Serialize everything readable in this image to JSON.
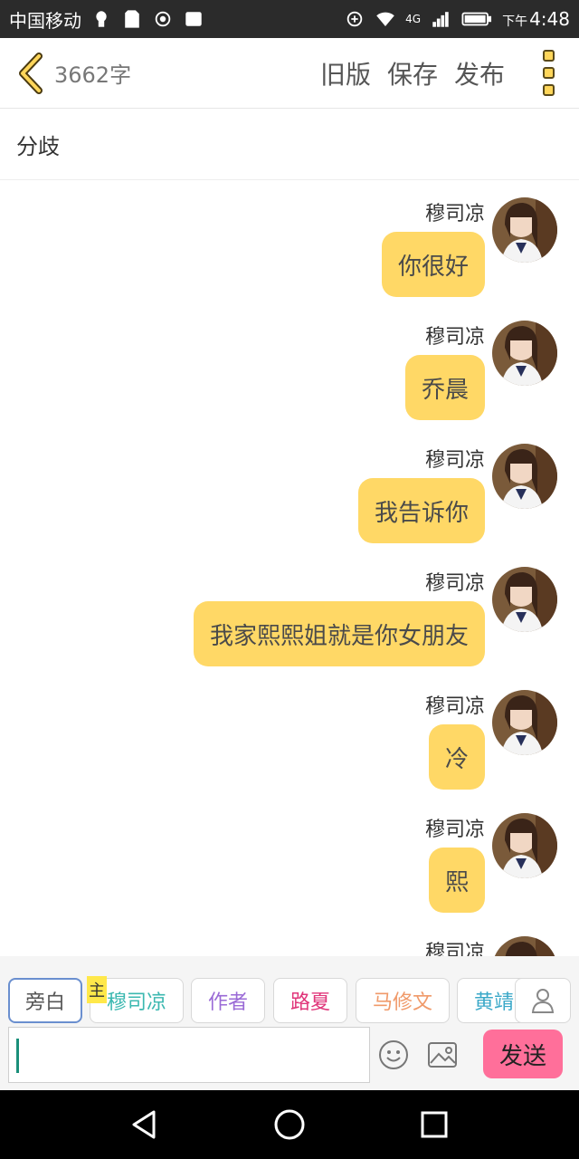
{
  "status_bar": {
    "carrier": "中国移动",
    "time_prefix": "下午",
    "time": "4:48",
    "network": "4G"
  },
  "header": {
    "word_count": "3662字",
    "actions": [
      "旧版",
      "保存",
      "发布"
    ]
  },
  "chapter_title": "分歧",
  "messages": [
    {
      "name": "穆司凉",
      "text": "你很好"
    },
    {
      "name": "穆司凉",
      "text": "乔晨"
    },
    {
      "name": "穆司凉",
      "text": "我告诉你"
    },
    {
      "name": "穆司凉",
      "text": "我家熙熙姐就是你女朋友"
    },
    {
      "name": "穆司凉",
      "text": "冷"
    },
    {
      "name": "穆司凉",
      "text": "熙"
    },
    {
      "name": "穆司凉",
      "text": ""
    }
  ],
  "roles": [
    {
      "label": "旁白",
      "color": "#555555"
    },
    {
      "label": "穆司凉",
      "color": "#3bb8b0"
    },
    {
      "label": "作者",
      "color": "#9a6ad6"
    },
    {
      "label": "路夏",
      "color": "#e0357a"
    },
    {
      "label": "马修文",
      "color": "#f09a6a"
    },
    {
      "label": "黄靖",
      "color": "#3aa8c8"
    }
  ],
  "host_tag": "主",
  "input": {
    "value": "",
    "send_label": "发送"
  },
  "colors": {
    "bubble": "#ffd866",
    "send_button": "#ff6f9a",
    "accent_caret": "#1a8f7a"
  }
}
